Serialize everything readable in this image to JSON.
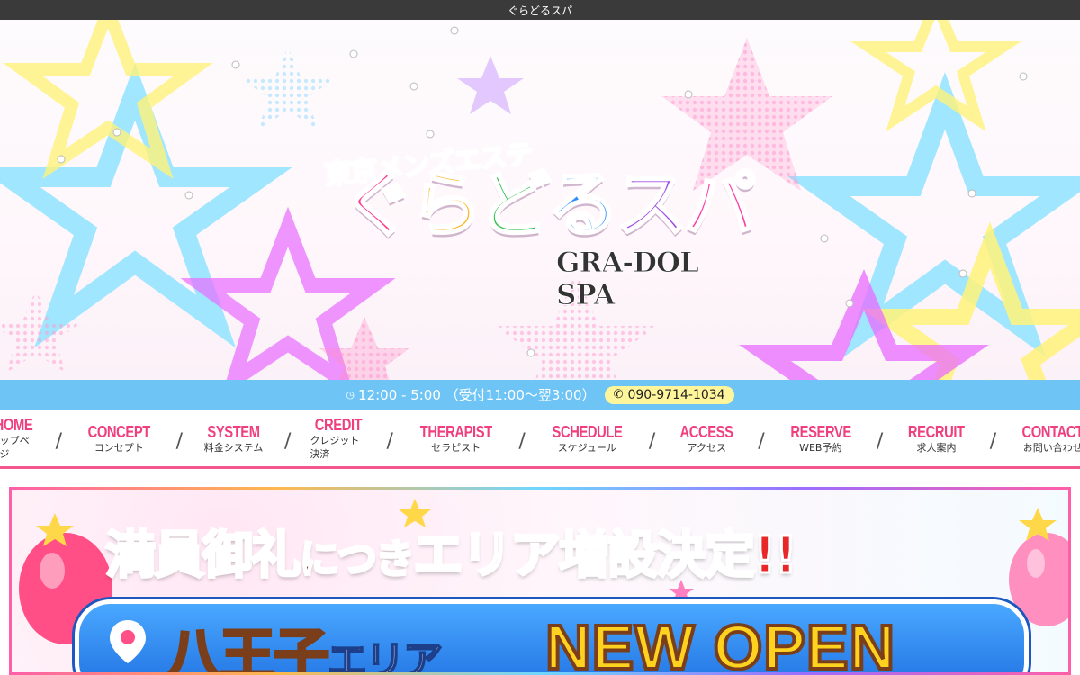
{
  "site": {
    "title": "ぐらどるスパ"
  },
  "hero": {
    "logo_subtitle": "東京メンズエステ",
    "logo_main": [
      "ぐ",
      "ら",
      "ど",
      "る",
      "ス",
      "パ"
    ],
    "logo_english": "GRA-DOL SPA"
  },
  "info": {
    "clock_icon": "clock-icon",
    "hours": "12:00 - 5:00 （受付11:00～翌3:00）",
    "phone_icon": "phone-icon",
    "phone": "090-9714-1034"
  },
  "nav": {
    "items": [
      {
        "en": "HOME",
        "jp": "トップページ"
      },
      {
        "en": "CONCEPT",
        "jp": "コンセプト"
      },
      {
        "en": "SYSTEM",
        "jp": "料金システム"
      },
      {
        "en": "CREDIT",
        "jp": "クレジット決済"
      },
      {
        "en": "THERAPIST",
        "jp": "セラピスト"
      },
      {
        "en": "SCHEDULE",
        "jp": "スケジュール"
      },
      {
        "en": "ACCESS",
        "jp": "アクセス"
      },
      {
        "en": "RESERVE",
        "jp": "WEB予約"
      },
      {
        "en": "RECRUIT",
        "jp": "求人案内"
      },
      {
        "en": "CONTACT",
        "jp": "お問い合わせ"
      }
    ],
    "separator": "/"
  },
  "banner": {
    "title_parts": [
      "満",
      "員",
      "御",
      "礼",
      "につき",
      "エリア増設決定!!"
    ],
    "area": "八王子",
    "area_suffix": "エリア",
    "headline": "NEW OPEN"
  },
  "colors": {
    "nav_accent": "#ef3f7e",
    "info_bar": "#6ec5f5",
    "phone_pill": "#fff59a"
  }
}
